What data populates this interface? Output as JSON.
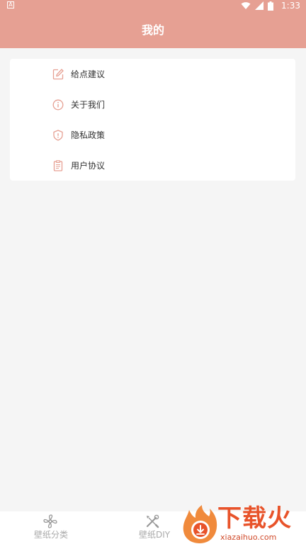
{
  "status_bar": {
    "notification_badge": "A",
    "time": "1:33",
    "icons": [
      "wifi-icon",
      "signal-icon",
      "battery-icon"
    ]
  },
  "header": {
    "title": "我的",
    "background": "#e6a093"
  },
  "menu": {
    "items": [
      {
        "label": "给点建议",
        "icon": "edit-icon"
      },
      {
        "label": "关于我们",
        "icon": "info-icon"
      },
      {
        "label": "隐私政策",
        "icon": "shield-icon"
      },
      {
        "label": "用户协议",
        "icon": "clipboard-icon"
      }
    ],
    "icon_color": "#e6a093"
  },
  "bottom_nav": {
    "tabs": [
      {
        "label": "壁纸分类",
        "icon": "fan-icon"
      },
      {
        "label": "壁纸DIY",
        "icon": "tools-icon"
      }
    ]
  },
  "watermark": {
    "text": "下载火",
    "subtext": "xiazaihuo.com"
  }
}
